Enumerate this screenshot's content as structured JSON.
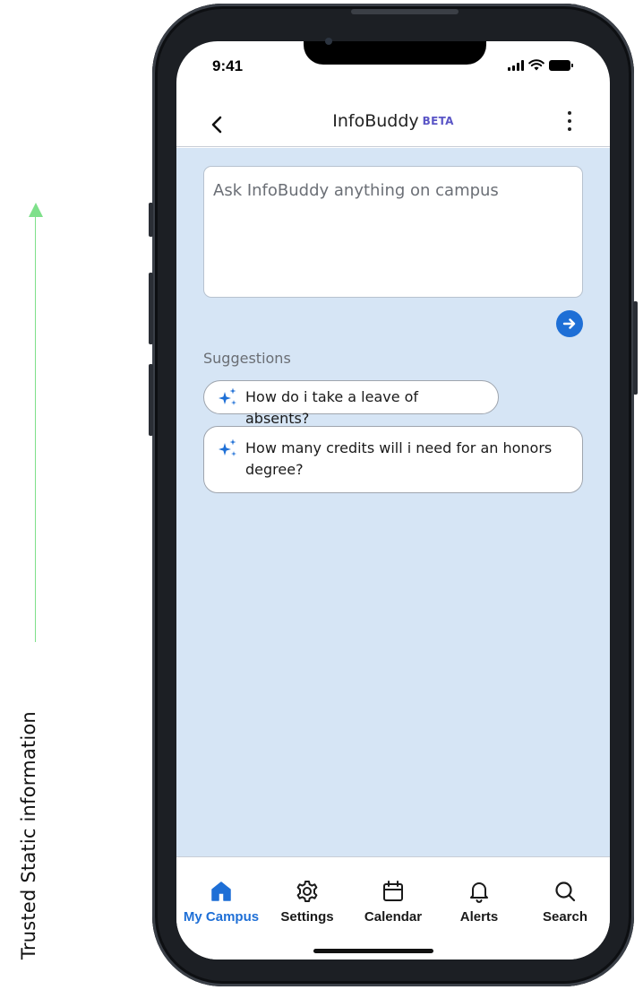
{
  "annotation": {
    "side_label": "Trusted Static information",
    "arrow_color": "#7ee08a"
  },
  "status_bar": {
    "time": "9:41",
    "icons": [
      "signal-icon",
      "wifi-icon",
      "battery-icon"
    ]
  },
  "header": {
    "back_icon": "chevron-left-icon",
    "title": "InfoBuddy",
    "badge": "BETA",
    "menu_icon": "kebab-menu-icon"
  },
  "main": {
    "ask_placeholder": "Ask InfoBuddy anything on campus",
    "send_icon": "arrow-right-circle-icon",
    "suggestions_title": "Suggestions",
    "suggestions": [
      {
        "icon": "sparkle-icon",
        "text": "How do i take a leave of absents?"
      },
      {
        "icon": "sparkle-icon",
        "text": "How many credits will i need for an honors degree?"
      }
    ]
  },
  "bottom_nav": {
    "items": [
      {
        "label": "My Campus",
        "icon": "home-icon",
        "active": true
      },
      {
        "label": "Settings",
        "icon": "gear-icon",
        "active": false
      },
      {
        "label": "Calendar",
        "icon": "calendar-icon",
        "active": false
      },
      {
        "label": "Alerts",
        "icon": "bell-icon",
        "active": false
      },
      {
        "label": "Search",
        "icon": "search-icon",
        "active": false
      }
    ]
  },
  "colors": {
    "accent": "#1e6fd6",
    "content_background": "#d6e5f5",
    "beta_badge": "#5a55c6"
  }
}
